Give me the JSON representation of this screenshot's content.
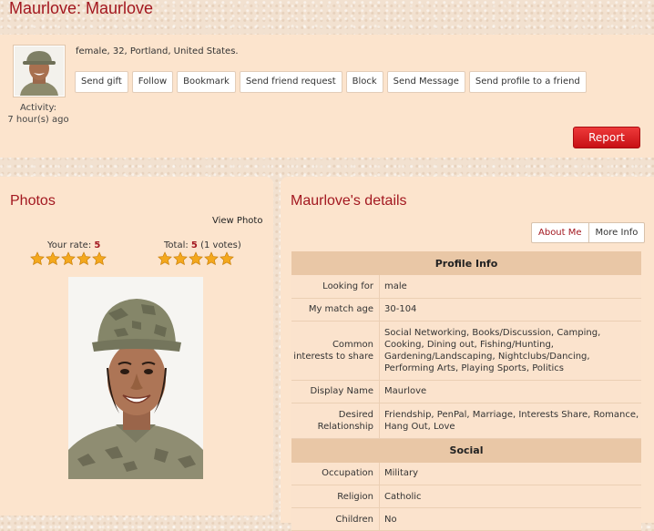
{
  "header": {
    "title": "Maurlove: Maurlove"
  },
  "profile": {
    "summary": "female, 32, Portland, United States.",
    "activity_label": "Activity:",
    "activity_value": "7 hour(s) ago",
    "actions": [
      "Send gift",
      "Follow",
      "Bookmark",
      "Send friend request",
      "Block",
      "Send Message",
      "Send profile to a friend"
    ],
    "report_label": "Report"
  },
  "photos": {
    "title": "Photos",
    "view_photo": "View Photo",
    "your_rate_label": "Your rate:",
    "your_rate_value": "5",
    "total_label": "Total:",
    "total_value": "5",
    "total_votes": "(1 votes)",
    "star_color": "#f4a81d"
  },
  "details": {
    "title": "Maurlove's details",
    "tabs": [
      "About Me",
      "More Info"
    ],
    "sections": [
      {
        "heading": "Profile Info",
        "rows": [
          {
            "key": "Looking for",
            "value": "male"
          },
          {
            "key": "My match age",
            "value": "30-104"
          },
          {
            "key": "Common interests to share",
            "value": "Social Networking, Books/Discussion, Camping, Cooking, Dining out, Fishing/Hunting, Gardening/Landscaping, Nightclubs/Dancing, Performing Arts, Playing Sports, Politics"
          },
          {
            "key": "Display Name",
            "value": "Maurlove"
          },
          {
            "key": "Desired Relationship",
            "value": "Friendship, PenPal, Marriage, Interests Share, Romance, Hang Out, Love"
          }
        ]
      },
      {
        "heading": "Social",
        "rows": [
          {
            "key": "Occupation",
            "value": "Military"
          },
          {
            "key": "Religion",
            "value": "Catholic"
          },
          {
            "key": "Children",
            "value": "No"
          }
        ]
      }
    ]
  },
  "colors": {
    "accent": "#a31820",
    "panel": "#fce4cd",
    "header_row": "#e9c7a6",
    "report": "#d9151b"
  }
}
